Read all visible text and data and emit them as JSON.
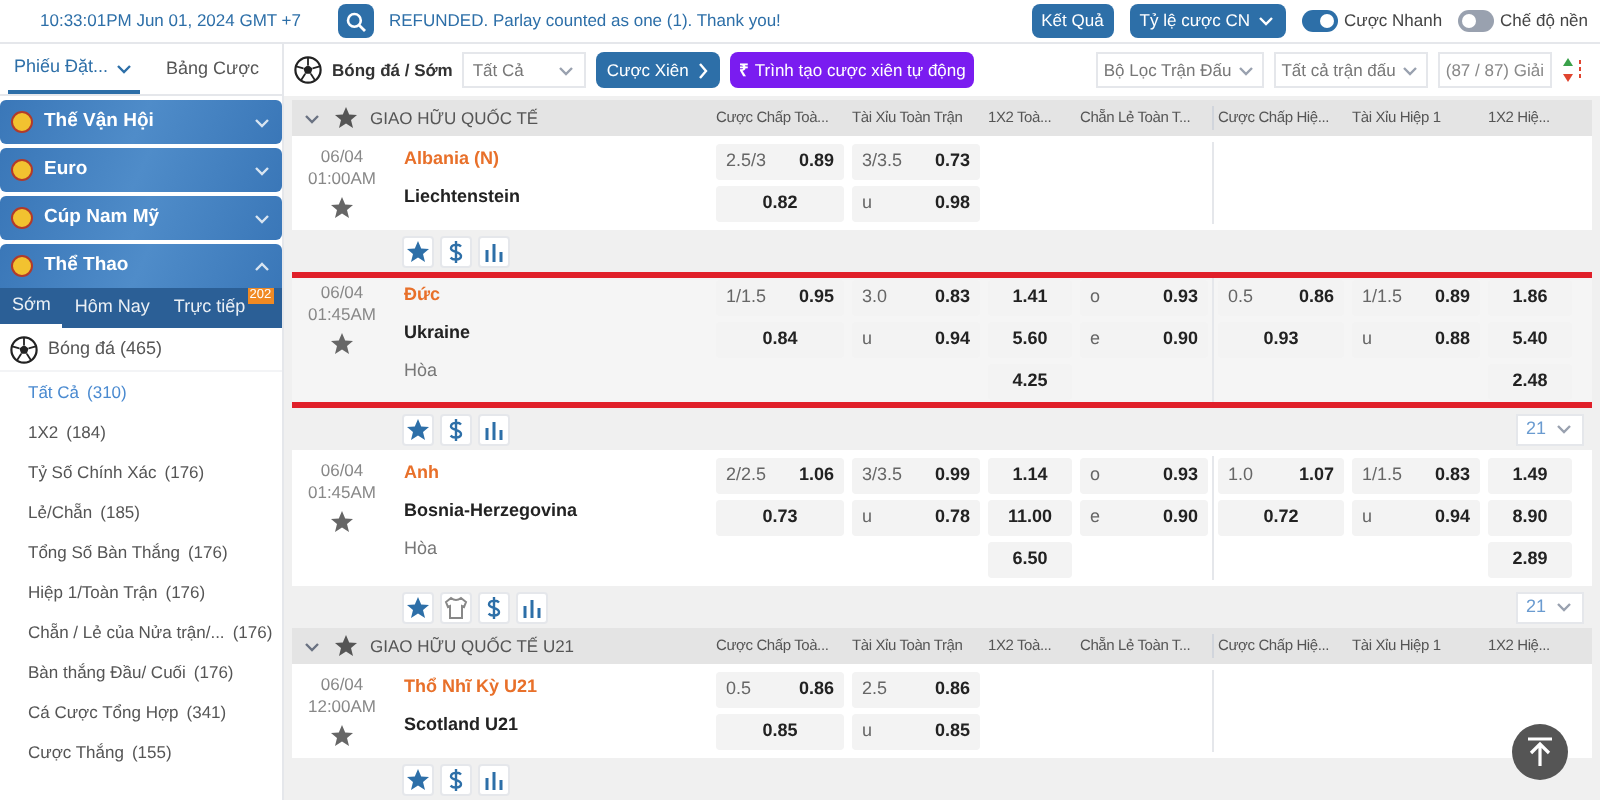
{
  "top_bar": {
    "datetime": "10:33:01PM Jun 01, 2024 GMT +7",
    "notice": "REFUNDED. Parlay counted as one (1). Thank you!",
    "buttons": [
      {
        "label": "Kết Quả",
        "dropdown": false
      },
      {
        "label": "Tỷ lệ cược CN",
        "dropdown": true
      }
    ],
    "toggles": [
      {
        "label": "Cược Nhanh",
        "on": true
      },
      {
        "label": "Chế độ nền",
        "on": false
      }
    ]
  },
  "sidebar": {
    "tabs": [
      {
        "label": "Phiếu Đặt...",
        "selected": true,
        "dropdown": true
      },
      {
        "label": "Bảng Cược",
        "selected": false,
        "dropdown": false
      }
    ],
    "categories": [
      {
        "label": "Thế Vận Hội",
        "expanded": false
      },
      {
        "label": "Euro",
        "expanded": false
      },
      {
        "label": "Cúp Nam Mỹ",
        "expanded": false
      },
      {
        "label": "Thể Thao",
        "expanded": true
      }
    ],
    "period_tabs": [
      {
        "label": "Sớm",
        "selected": true
      },
      {
        "label": "Hôm Nay",
        "selected": false
      },
      {
        "label": "Trực tiếp",
        "selected": false,
        "badge": "202"
      }
    ],
    "sport": {
      "label": "Bóng đá",
      "count": "(465)"
    },
    "bet_types": [
      {
        "label": "Tất Cả",
        "count": "(310)",
        "selected": true
      },
      {
        "label": "1X2",
        "count": "(184)",
        "selected": false
      },
      {
        "label": "Tỷ Số Chính Xác",
        "count": "(176)",
        "selected": false
      },
      {
        "label": "Lẻ/Chẵn",
        "count": "(185)",
        "selected": false
      },
      {
        "label": "Tổng Số Bàn Thắng",
        "count": "(176)",
        "selected": false
      },
      {
        "label": "Hiệp 1/Toàn Trận",
        "count": "(176)",
        "selected": false
      },
      {
        "label": "Chẵn / Lẻ của Nửa trận/...",
        "count": "(176)",
        "selected": false
      },
      {
        "label": "Bàn thắng Đầu/ Cuối",
        "count": "(176)",
        "selected": false
      },
      {
        "label": "Cá Cược Tổng Hợp",
        "count": "(341)",
        "selected": false
      },
      {
        "label": "Cược Thắng",
        "count": "(155)",
        "selected": false
      }
    ]
  },
  "toolbar": {
    "breadcrumb": "Bóng đá / Sớm",
    "market_select": "Tất Cả",
    "parlay_button": "Cược Xiên",
    "auto_parlay_symbol": "₹",
    "auto_parlay_button": "Trình tạo cược xiên tự động",
    "filters": [
      "Bộ Lọc Trận Đấu",
      "Tất cả trận đấu"
    ],
    "league_count": "(87 / 87) Giải"
  },
  "leagues": [
    {
      "name": "GIAO HỮU QUỐC TẾ",
      "columns": [
        "Cược Chấp Toà...",
        "Tài Xỉu Toàn Trận",
        "1X2 Toà...",
        "Chẵn Lẻ Toàn T...",
        "Cược Chấp Hiệ...",
        "Tài Xỉu Hiệp 1",
        "1X2 Hiệ..."
      ],
      "matches": [
        {
          "date": "06/04",
          "time": "01:00AM",
          "home": "Albania (N)",
          "away": "Liechtenstein",
          "highlighted": false,
          "tools": [
            {
              "kind": "star"
            },
            {
              "kind": "dollar"
            },
            {
              "kind": "chart"
            }
          ],
          "markets": {
            "handicap_ft": [
              {
                "label": "2.5/3",
                "value": "0.89"
              },
              {
                "value": "0.82"
              }
            ],
            "over_under_ft": [
              {
                "label": "3/3.5",
                "value": "0.73"
              },
              {
                "label": "u",
                "value": "0.98"
              }
            ]
          }
        },
        {
          "date": "06/04",
          "time": "01:45AM",
          "home": "Đức",
          "away": "Ukraine",
          "draw": "Hòa",
          "highlighted": true,
          "tools": [
            {
              "kind": "star"
            },
            {
              "kind": "dollar"
            },
            {
              "kind": "chart"
            }
          ],
          "more": "21",
          "markets": {
            "handicap_ft": [
              {
                "label": "1/1.5",
                "value": "0.95"
              },
              {
                "value": "0.84"
              }
            ],
            "over_under_ft": [
              {
                "label": "3.0",
                "value": "0.83"
              },
              {
                "label": "u",
                "value": "0.94"
              }
            ],
            "x12_ft": [
              {
                "value": "1.41"
              },
              {
                "value": "5.60"
              },
              {
                "value": "4.25"
              }
            ],
            "odd_even_ft": [
              {
                "label": "o",
                "value": "0.93"
              },
              {
                "label": "e",
                "value": "0.90"
              }
            ],
            "handicap_h1": [
              {
                "label": "0.5",
                "value": "0.86"
              },
              {
                "value": "0.93"
              }
            ],
            "over_under_h1": [
              {
                "label": "1/1.5",
                "value": "0.89"
              },
              {
                "label": "u",
                "value": "0.88"
              }
            ],
            "x12_h1": [
              {
                "value": "1.86"
              },
              {
                "value": "5.40"
              },
              {
                "value": "2.48"
              }
            ]
          }
        },
        {
          "date": "06/04",
          "time": "01:45AM",
          "home": "Anh",
          "away": "Bosnia-Herzegovina",
          "draw": "Hòa",
          "highlighted": false,
          "tools": [
            {
              "kind": "star"
            },
            {
              "kind": "shirt"
            },
            {
              "kind": "dollar"
            },
            {
              "kind": "chart"
            }
          ],
          "more": "21",
          "markets": {
            "handicap_ft": [
              {
                "label": "2/2.5",
                "value": "1.06"
              },
              {
                "value": "0.73"
              }
            ],
            "over_under_ft": [
              {
                "label": "3/3.5",
                "value": "0.99"
              },
              {
                "label": "u",
                "value": "0.78"
              }
            ],
            "x12_ft": [
              {
                "value": "1.14"
              },
              {
                "value": "11.00"
              },
              {
                "value": "6.50"
              }
            ],
            "odd_even_ft": [
              {
                "label": "o",
                "value": "0.93"
              },
              {
                "label": "e",
                "value": "0.90"
              }
            ],
            "handicap_h1": [
              {
                "label": "1.0",
                "value": "1.07"
              },
              {
                "value": "0.72"
              }
            ],
            "over_under_h1": [
              {
                "label": "1/1.5",
                "value": "0.83"
              },
              {
                "label": "u",
                "value": "0.94"
              }
            ],
            "x12_h1": [
              {
                "value": "1.49"
              },
              {
                "value": "8.90"
              },
              {
                "value": "2.89"
              }
            ]
          }
        }
      ]
    },
    {
      "name": "GIAO HỮU QUỐC TẾ U21",
      "columns": [
        "Cược Chấp Toà...",
        "Tài Xỉu Toàn Trận",
        "1X2 Toà...",
        "Chẵn Lẻ Toàn T...",
        "Cược Chấp Hiệ...",
        "Tài Xỉu Hiệp 1",
        "1X2 Hiệ..."
      ],
      "matches": [
        {
          "date": "06/04",
          "time": "12:00AM",
          "home": "Thổ Nhĩ Kỳ U21",
          "away": "Scotland U21",
          "highlighted": false,
          "tools": [
            {
              "kind": "star"
            },
            {
              "kind": "dollar"
            },
            {
              "kind": "chart"
            }
          ],
          "markets": {
            "handicap_ft": [
              {
                "label": "0.5",
                "value": "0.86"
              },
              {
                "value": "0.85"
              }
            ],
            "over_under_ft": [
              {
                "label": "2.5",
                "value": "0.86"
              },
              {
                "label": "u",
                "value": "0.85"
              }
            ]
          }
        }
      ]
    }
  ]
}
